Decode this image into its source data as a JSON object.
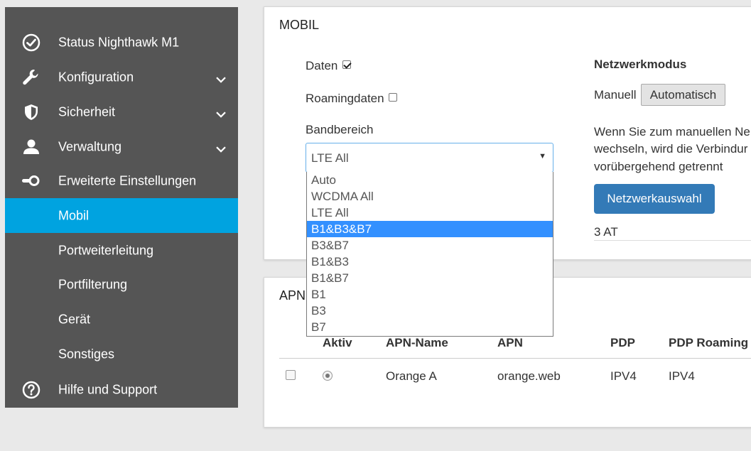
{
  "sidebar": {
    "items": [
      {
        "label": "Status Nighthawk M1",
        "icon": "check-circle-icon"
      },
      {
        "label": "Konfiguration",
        "icon": "wrench-icon"
      },
      {
        "label": "Sicherheit",
        "icon": "shield-icon"
      },
      {
        "label": "Verwaltung",
        "icon": "user-icon"
      },
      {
        "label": "Erweiterte Einstellungen",
        "icon": "key-toggle-icon"
      },
      {
        "label": "Mobil"
      },
      {
        "label": "Portweiterleitung"
      },
      {
        "label": "Portfilterung"
      },
      {
        "label": "Gerät"
      },
      {
        "label": "Sonstiges"
      },
      {
        "label": "Hilfe und Support",
        "icon": "help-circle-icon"
      }
    ],
    "active_label": "Mobil",
    "background": "#555555",
    "active_color": "#00a3e0"
  },
  "mobil": {
    "title": "MOBIL",
    "daten_label": "Daten",
    "daten_checked": true,
    "roaming_label": "Roamingdaten",
    "roaming_checked": false,
    "band_label": "Bandbereich",
    "band_selected": "LTE All",
    "band_options": [
      "Auto",
      "WCDMA All",
      "LTE All",
      "B1&B3&B7",
      "B3&B7",
      "B1&B3",
      "B1&B7",
      "B1",
      "B3",
      "B7"
    ],
    "band_highlighted": "B1&B3&B7",
    "netz_title": "Netzwerkmodus",
    "manuell_label": "Manuell",
    "automatisch_label": "Automatisch",
    "info_line1": "Wenn Sie zum manuellen Ne",
    "info_line2": "wechseln, wird die Verbindur",
    "info_line3": "vorübergehend getrennt",
    "netzauswahl_label": "Netzwerkauswahl",
    "operator": "3 AT"
  },
  "apn": {
    "title": "APN",
    "headers": [
      "Aktiv",
      "APN-Name",
      "APN",
      "PDP",
      "PDP Roaming"
    ],
    "rows": [
      {
        "aktiv": true,
        "name": "Orange A",
        "apn": "orange.web",
        "pdp": "IPV4",
        "pdp_roaming": "IPV4"
      }
    ]
  }
}
